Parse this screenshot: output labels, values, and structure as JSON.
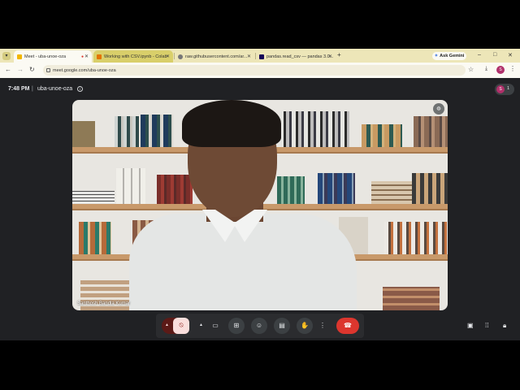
{
  "browser": {
    "tab_list_icon": "chevron-down-icon",
    "tabs": [
      {
        "title": "Meet - uba-unoe-oza",
        "favicon_color": "#f2b600"
      },
      {
        "title": "Working with CSV.ipynb - Colab",
        "favicon_color": "#e37400"
      },
      {
        "title": "raw.githubusercontent.com/ar...",
        "favicon_color": "#555555"
      },
      {
        "title": "pandas.read_csv — pandas 3.0...",
        "favicon_color": "#150458"
      }
    ],
    "new_tab": "+",
    "gemini": {
      "label": "Ask Gemini",
      "icon": "sparkle-icon"
    },
    "window_controls": {
      "minimize": "–",
      "maximize": "□",
      "close": "✕"
    },
    "url": "meet.google.com/uba-unoe-oza",
    "profile_initial": "S",
    "accent_color": "#f0e9c4"
  },
  "meet": {
    "time": "7:48 PM",
    "separator": "|",
    "meeting_code": "uba-unoe-oza",
    "info_icon": "i",
    "participant_initial": "S",
    "participant_count": "1",
    "tile": {
      "name": "Santhosh Bandla Kumar",
      "muted_icon": "mic-off-icon"
    },
    "controls": {
      "mic_icon": "mic-off-icon",
      "camera_icon": "camera-icon",
      "present_icon": "present-icon",
      "emoji_icon": "emoji-icon",
      "captions_icon": "captions-icon",
      "hand_icon": "raise-hand-icon",
      "more_icon": "more-vert-icon",
      "end_call_icon": "call-end-icon",
      "end_call_color": "#dc362e"
    },
    "right_controls": [
      "chat-icon",
      "activities-icon",
      "lock-icon"
    ]
  }
}
